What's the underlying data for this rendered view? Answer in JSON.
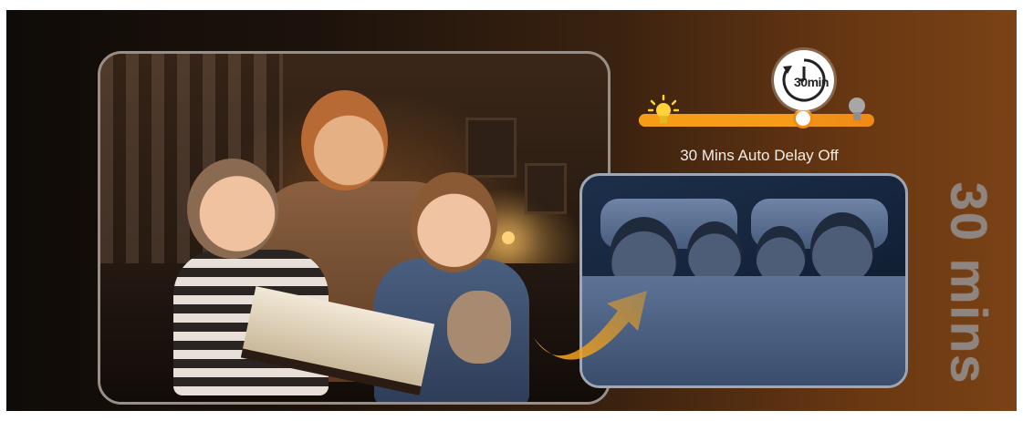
{
  "timeline": {
    "caption": "30 Mins Auto Delay Off",
    "timer_label": "30min",
    "progress": 0.71,
    "colors": {
      "track": "#f7a21b",
      "knob_border": "#f08a14",
      "bulb_on": "#ffd23a",
      "bulb_off": "#a7a7a7"
    },
    "icons": {
      "start": "lit-bulb-icon",
      "end": "unlit-bulb-icon",
      "timer": "timer-clock-icon"
    }
  },
  "side_text": "30 mins",
  "images": {
    "main": "family-reading-photo",
    "secondary": "family-sleeping-photo",
    "transition": "curved-arrow-icon"
  }
}
